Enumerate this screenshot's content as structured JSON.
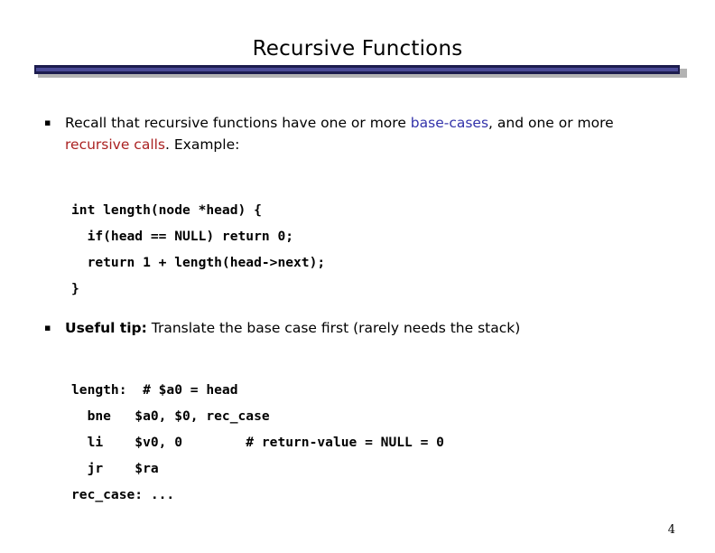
{
  "slide": {
    "title": "Recursive Functions",
    "page_number": "4",
    "accent_color": "#4a4a96",
    "accent_border_color": "#1c1c4e",
    "shadow_color": "#b3b3b3",
    "background_color": "#ffffff",
    "base_case_color": "#3333aa",
    "recursive_call_color": "#aa2222"
  },
  "bullets": [
    {
      "marker": "▪",
      "segments": [
        {
          "text": "Recall that recursive functions have one or more ",
          "style": "normal"
        },
        {
          "text": "base-cases",
          "style": "blue"
        },
        {
          "text": ", and one or more ",
          "style": "normal"
        },
        {
          "text": "recursive calls",
          "style": "red"
        },
        {
          "text": ". Example:",
          "style": "normal"
        }
      ],
      "plain": "Recall that recursive functions have one or more base-cases, and one or more recursive calls. Example:"
    },
    {
      "marker": "▪",
      "segments": [
        {
          "text": "Useful tip:",
          "style": "bold"
        },
        {
          "text": " Translate the base case first (rarely needs the stack)",
          "style": "normal"
        }
      ],
      "plain": "Useful tip: Translate the base case first (rarely needs the stack)"
    }
  ],
  "code_blocks": [
    {
      "name": "c-source",
      "language": "c",
      "lines": [
        "int length(node *head) {",
        "  if(head == NULL) return 0;",
        "  return 1 + length(head->next);",
        "}"
      ],
      "text": "int length(node *head) {\n  if(head == NULL) return 0;\n  return 1 + length(head->next);\n}"
    },
    {
      "name": "mips-assembly",
      "language": "mips",
      "lines": [
        "length:  # $a0 = head",
        "  bne   $a0, $0, rec_case",
        "  li    $v0, 0        # return-value = NULL = 0",
        "  jr    $ra",
        "rec_case: ..."
      ],
      "text": "length:  # $a0 = head\n  bne   $a0, $0, rec_case\n  li    $v0, 0        # return-value = NULL = 0\n  jr    $ra\nrec_case: ..."
    }
  ]
}
